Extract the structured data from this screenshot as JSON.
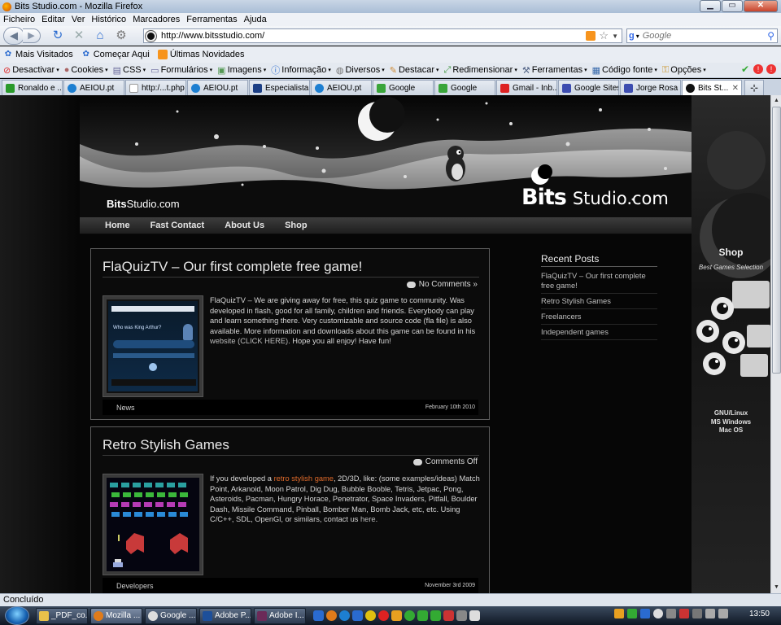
{
  "window": {
    "title": "Bits Studio.com - Mozilla Firefox"
  },
  "menubar": [
    "Ficheiro",
    "Editar",
    "Ver",
    "Histórico",
    "Marcadores",
    "Ferramentas",
    "Ajuda"
  ],
  "address": {
    "url": "http://www.bitsstudio.com/"
  },
  "search": {
    "engine": "Google",
    "placeholder": "Google"
  },
  "bookmarks": [
    "Mais Visitados",
    "Começar Aqui",
    "Últimas Novidades"
  ],
  "devtoolbar": [
    "Desactivar",
    "Cookies",
    "CSS",
    "Formulários",
    "Imagens",
    "Informação",
    "Diversos",
    "Destacar",
    "Redimensionar",
    "Ferramentas",
    "Código fonte",
    "Opções"
  ],
  "tabs": [
    {
      "label": "Ronaldo e ...",
      "icon_color": "#2a9a2a"
    },
    {
      "label": "AEIOU.pt",
      "icon_color": "#1d7fd1"
    },
    {
      "label": "http:/...t.php",
      "icon_color": "#ffffff"
    },
    {
      "label": "AEIOU.pt",
      "icon_color": "#1d7fd1"
    },
    {
      "label": "Especialista...",
      "icon_color": "#1c3f85"
    },
    {
      "label": "AEIOU.pt",
      "icon_color": "#1d7fd1"
    },
    {
      "label": "Google",
      "icon_color": "#3aa53a"
    },
    {
      "label": "Google",
      "icon_color": "#3aa53a"
    },
    {
      "label": "Gmail - Inb...",
      "icon_color": "#d22"
    },
    {
      "label": "Google Sites",
      "icon_color": "#3d4db0"
    },
    {
      "label": "Jorge Rosa ...",
      "icon_color": "#3d4db0"
    },
    {
      "label": "Bits St...",
      "icon_color": "#111111",
      "active": true
    }
  ],
  "site": {
    "logo_small_bold": "Bits",
    "logo_small_rest": "Studio.com",
    "brand_bold": "Bits",
    "brand_rest": "Studio.com",
    "nav": [
      "Home",
      "Fast Contact",
      "About Us",
      "Shop"
    ],
    "posts": [
      {
        "title": "FlaQuizTV – Our first complete free game!",
        "comments": "No Comments »",
        "body_before": "FlaQuizTV – We are giving away for free, this quiz game to community. Was developed in flash, good for all family, children and friends. Everybody can play and learn something there. Very customizable and source code (fla file) is also available.  More information and downloads about this game can be found in his ",
        "link1": "website (CLICK HERE)",
        "body_after": ". Hope you all enjoy! Have fun!",
        "category": "News",
        "date": "February 10th 2010",
        "thumb_text": "Who was King Arthur?"
      },
      {
        "title": "Retro Stylish Games",
        "comments": "Comments Off",
        "body_before": "If you developed a ",
        "link1": "retro stylish game",
        "body_after": ", 2D/3D, like: (some examples/ideas) Match Point, Arkanoid, Moon Patrol, Dig Dug, Bubble Booble, Tetris, Jetpac, Pong, Asteroids, Pacman, Hungry Horace, Penetrator, Space Invaders, Pitfall, Boulder Dash, Missile Command, Pinball, Bomber Man, Bomb Jack, etc, etc. Using C/C++, SDL, OpenGl, or similars, contact us ",
        "link2": "here",
        "body_end": ".",
        "category": "Developers",
        "date": "November 3rd 2009"
      }
    ],
    "sidebar": {
      "heading": "Recent Posts",
      "items": [
        "FlaQuizTV – Our first complete free game!",
        "Retro Stylish Games",
        "Freelancers",
        "Independent games"
      ]
    },
    "ad": {
      "title": "Shop",
      "subtitle": "Best Games Selection",
      "os_lines": [
        "GNU/Linux",
        "MS Windows",
        "Mac OS"
      ]
    }
  },
  "status": "Concluído",
  "taskbar": {
    "buttons": [
      {
        "label": "_PDF_co...",
        "icon_color": "#e8c14a"
      },
      {
        "label": "Mozilla ...",
        "icon_color": "#e07b1a",
        "active": true
      },
      {
        "label": "Google ...",
        "icon_color": "#dddddd"
      },
      {
        "label": "Adobe P...",
        "icon_color": "#1d4f9a"
      },
      {
        "label": "Adobe I...",
        "icon_color": "#6b2a58"
      }
    ],
    "clock": "13:50"
  },
  "colors": {
    "accent_link": "#e06a2a",
    "page_bg": "#060606"
  }
}
